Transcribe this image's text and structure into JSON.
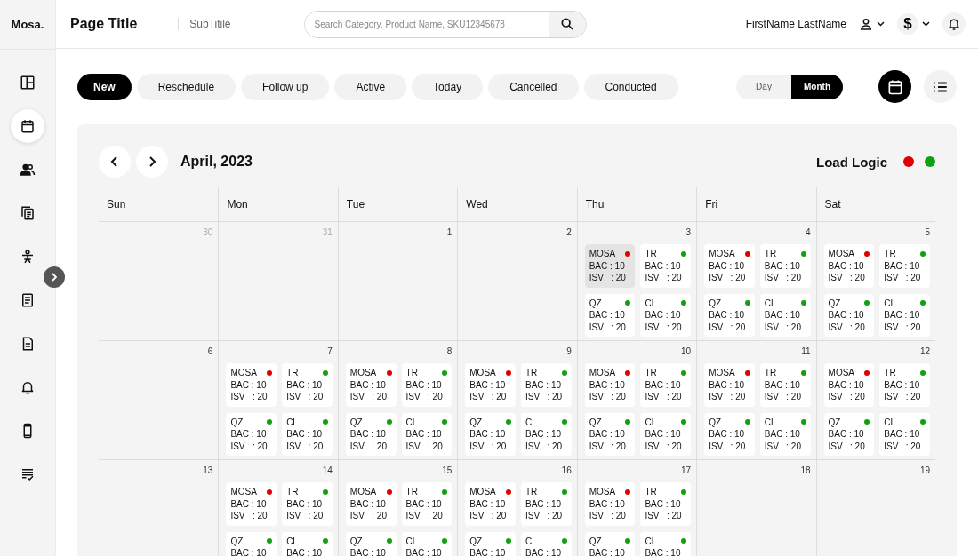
{
  "header": {
    "logo": "Mosa.",
    "title": "Page Title",
    "subtitle": "SubTitile",
    "search": {
      "placeholder": "Search Category, Product Name, SKU12345678"
    },
    "user_name": "FirstName LastName",
    "currency_symbol": "$"
  },
  "sidebar": {
    "items": [
      {
        "selected": false
      },
      {
        "selected": true
      },
      {
        "selected": false
      },
      {
        "selected": false
      },
      {
        "selected": false
      },
      {
        "selected": false
      },
      {
        "selected": false
      },
      {
        "selected": false
      },
      {
        "selected": false
      },
      {
        "selected": false
      }
    ]
  },
  "filters": [
    {
      "label": "New",
      "selected": true
    },
    {
      "label": "Reschedule",
      "selected": false
    },
    {
      "label": "Follow up",
      "selected": false
    },
    {
      "label": "Active",
      "selected": false
    },
    {
      "label": "Today",
      "selected": false
    },
    {
      "label": "Cancelled",
      "selected": false
    },
    {
      "label": "Conducted",
      "selected": false
    }
  ],
  "view_toggle": [
    {
      "label": "Day",
      "selected": false
    },
    {
      "label": "Month",
      "selected": true
    }
  ],
  "view_modes": [
    {
      "kind": "calendar",
      "selected": true
    },
    {
      "kind": "list",
      "selected": false
    }
  ],
  "calendar": {
    "month": "April, 2023",
    "legend": {
      "label": "Load Logic",
      "dots": [
        {
          "color": "#e00000"
        },
        {
          "color": "#10a010"
        }
      ]
    },
    "weekdays": [
      "Sun",
      "Mon",
      "Tue",
      "Wed",
      "Thu",
      "Fri",
      "Sat"
    ],
    "weeks": [
      [
        {
          "date": "30",
          "outside": true
        },
        {
          "date": "31",
          "outside": true
        },
        {
          "date": "1",
          "outside": false
        },
        {
          "date": "2",
          "outside": false
        },
        {
          "date": "3",
          "outside": false,
          "cards": [
            {
              "name": "MOSA",
              "color": "#e00000",
              "selected": true,
              "lines": [
                "BAC : 10",
                "ISV   : 20"
              ]
            },
            {
              "name": "TR",
              "color": "#10a010",
              "selected": false,
              "lines": [
                "BAC : 10",
                "ISV   : 20"
              ]
            },
            {
              "name": "QZ",
              "color": "#10a010",
              "selected": false,
              "lines": [
                "BAC : 10",
                "ISV   : 20"
              ]
            },
            {
              "name": "CL",
              "color": "#10a010",
              "selected": false,
              "lines": [
                "BAC : 10",
                "ISV   : 20"
              ]
            }
          ]
        },
        {
          "date": "4",
          "outside": false,
          "cards": [
            {
              "name": "MOSA",
              "color": "#e00000",
              "selected": false,
              "lines": [
                "BAC : 10",
                "ISV   : 20"
              ]
            },
            {
              "name": "TR",
              "color": "#10a010",
              "selected": false,
              "lines": [
                "BAC : 10",
                "ISV   : 20"
              ]
            },
            {
              "name": "QZ",
              "color": "#10a010",
              "selected": false,
              "lines": [
                "BAC : 10",
                "ISV   : 20"
              ]
            },
            {
              "name": "CL",
              "color": "#10a010",
              "selected": false,
              "lines": [
                "BAC : 10",
                "ISV   : 20"
              ]
            }
          ]
        },
        {
          "date": "5",
          "outside": false,
          "cards": [
            {
              "name": "MOSA",
              "color": "#e00000",
              "selected": false,
              "lines": [
                "BAC : 10",
                "ISV   : 20"
              ]
            },
            {
              "name": "TR",
              "color": "#10a010",
              "selected": false,
              "lines": [
                "BAC : 10",
                "ISV   : 20"
              ]
            },
            {
              "name": "QZ",
              "color": "#10a010",
              "selected": false,
              "lines": [
                "BAC : 10",
                "ISV   : 20"
              ]
            },
            {
              "name": "CL",
              "color": "#10a010",
              "selected": false,
              "lines": [
                "BAC : 10",
                "ISV   : 20"
              ]
            }
          ]
        }
      ],
      [
        {
          "date": "6",
          "outside": false
        },
        {
          "date": "7",
          "outside": false,
          "cards": [
            {
              "name": "MOSA",
              "color": "#e00000",
              "selected": false,
              "lines": [
                "BAC : 10",
                "ISV   : 20"
              ]
            },
            {
              "name": "TR",
              "color": "#10a010",
              "selected": false,
              "lines": [
                "BAC : 10",
                "ISV   : 20"
              ]
            },
            {
              "name": "QZ",
              "color": "#10a010",
              "selected": false,
              "lines": [
                "BAC : 10",
                "ISV   : 20"
              ]
            },
            {
              "name": "CL",
              "color": "#10a010",
              "selected": false,
              "lines": [
                "BAC : 10",
                "ISV   : 20"
              ]
            }
          ]
        },
        {
          "date": "8",
          "outside": false,
          "cards": [
            {
              "name": "MOSA",
              "color": "#e00000",
              "selected": false,
              "lines": [
                "BAC : 10",
                "ISV   : 20"
              ]
            },
            {
              "name": "TR",
              "color": "#10a010",
              "selected": false,
              "lines": [
                "BAC : 10",
                "ISV   : 20"
              ]
            },
            {
              "name": "QZ",
              "color": "#10a010",
              "selected": false,
              "lines": [
                "BAC : 10",
                "ISV   : 20"
              ]
            },
            {
              "name": "CL",
              "color": "#10a010",
              "selected": false,
              "lines": [
                "BAC : 10",
                "ISV   : 20"
              ]
            }
          ]
        },
        {
          "date": "9",
          "outside": false,
          "cards": [
            {
              "name": "MOSA",
              "color": "#e00000",
              "selected": false,
              "lines": [
                "BAC : 10",
                "ISV   : 20"
              ]
            },
            {
              "name": "TR",
              "color": "#10a010",
              "selected": false,
              "lines": [
                "BAC : 10",
                "ISV   : 20"
              ]
            },
            {
              "name": "QZ",
              "color": "#10a010",
              "selected": false,
              "lines": [
                "BAC : 10",
                "ISV   : 20"
              ]
            },
            {
              "name": "CL",
              "color": "#10a010",
              "selected": false,
              "lines": [
                "BAC : 10",
                "ISV   : 20"
              ]
            }
          ]
        },
        {
          "date": "10",
          "outside": false,
          "cards": [
            {
              "name": "MOSA",
              "color": "#e00000",
              "selected": false,
              "lines": [
                "BAC : 10",
                "ISV   : 20"
              ]
            },
            {
              "name": "TR",
              "color": "#10a010",
              "selected": false,
              "lines": [
                "BAC : 10",
                "ISV   : 20"
              ]
            },
            {
              "name": "QZ",
              "color": "#10a010",
              "selected": false,
              "lines": [
                "BAC : 10",
                "ISV   : 20"
              ]
            },
            {
              "name": "CL",
              "color": "#10a010",
              "selected": false,
              "lines": [
                "BAC : 10",
                "ISV   : 20"
              ]
            }
          ]
        },
        {
          "date": "11",
          "outside": false,
          "cards": [
            {
              "name": "MOSA",
              "color": "#e00000",
              "selected": false,
              "lines": [
                "BAC : 10",
                "ISV   : 20"
              ]
            },
            {
              "name": "TR",
              "color": "#10a010",
              "selected": false,
              "lines": [
                "BAC : 10",
                "ISV   : 20"
              ]
            },
            {
              "name": "QZ",
              "color": "#10a010",
              "selected": false,
              "lines": [
                "BAC : 10",
                "ISV   : 20"
              ]
            },
            {
              "name": "CL",
              "color": "#10a010",
              "selected": false,
              "lines": [
                "BAC : 10",
                "ISV   : 20"
              ]
            }
          ]
        },
        {
          "date": "12",
          "outside": false,
          "cards": [
            {
              "name": "MOSA",
              "color": "#e00000",
              "selected": false,
              "lines": [
                "BAC : 10",
                "ISV   : 20"
              ]
            },
            {
              "name": "TR",
              "color": "#10a010",
              "selected": false,
              "lines": [
                "BAC : 10",
                "ISV   : 20"
              ]
            },
            {
              "name": "QZ",
              "color": "#10a010",
              "selected": false,
              "lines": [
                "BAC : 10",
                "ISV   : 20"
              ]
            },
            {
              "name": "CL",
              "color": "#10a010",
              "selected": false,
              "lines": [
                "BAC : 10",
                "ISV   : 20"
              ]
            }
          ]
        }
      ],
      [
        {
          "date": "13",
          "outside": false
        },
        {
          "date": "14",
          "outside": false,
          "cards": [
            {
              "name": "MOSA",
              "color": "#e00000",
              "selected": false,
              "lines": [
                "BAC : 10",
                "ISV   : 20"
              ]
            },
            {
              "name": "TR",
              "color": "#10a010",
              "selected": false,
              "lines": [
                "BAC : 10",
                "ISV   : 20"
              ]
            },
            {
              "name": "QZ",
              "color": "#10a010",
              "selected": false,
              "lines": [
                "BAC : 10"
              ]
            },
            {
              "name": "CL",
              "color": "#10a010",
              "selected": false,
              "lines": [
                "BAC : 10"
              ]
            }
          ]
        },
        {
          "date": "15",
          "outside": false,
          "cards": [
            {
              "name": "MOSA",
              "color": "#e00000",
              "selected": false,
              "lines": [
                "BAC : 10",
                "ISV   : 20"
              ]
            },
            {
              "name": "TR",
              "color": "#10a010",
              "selected": false,
              "lines": [
                "BAC : 10",
                "ISV   : 20"
              ]
            },
            {
              "name": "QZ",
              "color": "#10a010",
              "selected": false,
              "lines": [
                "BAC : 10"
              ]
            },
            {
              "name": "CL",
              "color": "#10a010",
              "selected": false,
              "lines": [
                "BAC : 10"
              ]
            }
          ]
        },
        {
          "date": "16",
          "outside": false,
          "cards": [
            {
              "name": "MOSA",
              "color": "#e00000",
              "selected": false,
              "lines": [
                "BAC : 10",
                "ISV   : 20"
              ]
            },
            {
              "name": "TR",
              "color": "#10a010",
              "selected": false,
              "lines": [
                "BAC : 10",
                "ISV   : 20"
              ]
            },
            {
              "name": "QZ",
              "color": "#10a010",
              "selected": false,
              "lines": [
                "BAC : 10"
              ]
            },
            {
              "name": "CL",
              "color": "#10a010",
              "selected": false,
              "lines": [
                "BAC : 10"
              ]
            }
          ]
        },
        {
          "date": "17",
          "outside": false,
          "cards": [
            {
              "name": "MOSA",
              "color": "#e00000",
              "selected": false,
              "lines": [
                "BAC : 10",
                "ISV   : 20"
              ]
            },
            {
              "name": "TR",
              "color": "#10a010",
              "selected": false,
              "lines": [
                "BAC : 10",
                "ISV   : 20"
              ]
            },
            {
              "name": "QZ",
              "color": "#10a010",
              "selected": false,
              "lines": [
                "BAC : 10"
              ]
            },
            {
              "name": "CL",
              "color": "#10a010",
              "selected": false,
              "lines": [
                "BAC : 10"
              ]
            }
          ]
        },
        {
          "date": "18",
          "outside": false
        },
        {
          "date": "19",
          "outside": false
        }
      ]
    ]
  }
}
